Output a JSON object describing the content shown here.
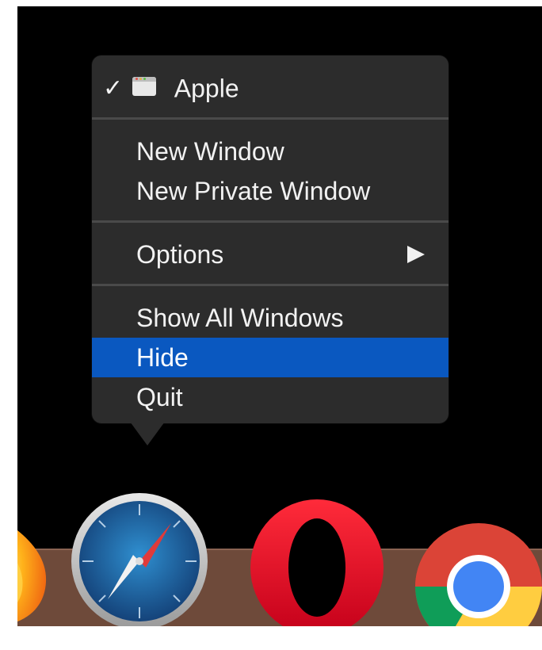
{
  "context_menu": {
    "app_title": "Apple",
    "checked": true,
    "items": [
      {
        "label": "New Window"
      },
      {
        "label": "New Private Window"
      },
      {
        "label": "Options",
        "has_submenu": true
      },
      {
        "label": "Show All Windows"
      },
      {
        "label": "Hide",
        "highlighted": true
      },
      {
        "label": "Quit"
      }
    ],
    "highlight_color": "#0a58c0"
  },
  "dock": {
    "icons": [
      {
        "name": "firefox",
        "icon": "firefox-icon"
      },
      {
        "name": "safari",
        "icon": "safari-icon"
      },
      {
        "name": "opera",
        "icon": "opera-icon"
      },
      {
        "name": "chrome",
        "icon": "chrome-icon"
      }
    ]
  },
  "colors": {
    "menu_background": "#2c2c2c",
    "screen_background": "#000000",
    "dock_shelf": "#6e4a3a"
  }
}
